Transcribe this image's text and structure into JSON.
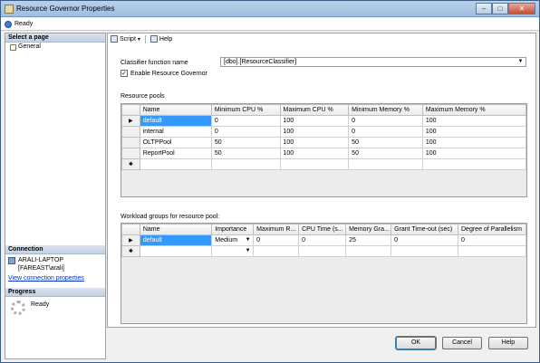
{
  "window": {
    "title": "Resource Governor Properties"
  },
  "status": {
    "text": "Ready"
  },
  "left": {
    "select_header": "Select a page",
    "pages": [
      "General"
    ],
    "connection_header": "Connection",
    "server": "ARALI-LAPTOP",
    "user": "[FAREAST\\arali]",
    "view_link": "View connection properties",
    "progress_header": "Progress",
    "progress_text": "Ready"
  },
  "toolbar": {
    "script": "Script",
    "help": "Help"
  },
  "form": {
    "classifier_label": "Classifier function name",
    "classifier_value": "[dbo].[ResourceClassifier]",
    "enable_label": "Enable Resource Governor",
    "pools_label": "Resource pools",
    "workload_label": "Workload groups for resource pool:"
  },
  "pools": {
    "headers": [
      "Name",
      "Minimum CPU %",
      "Maximum CPU %",
      "Minimum Memory %",
      "Maximum Memory %"
    ],
    "rows": [
      [
        "default",
        "0",
        "100",
        "0",
        "100"
      ],
      [
        "internal",
        "0",
        "100",
        "0",
        "100"
      ],
      [
        "OLTPPool",
        "50",
        "100",
        "50",
        "100"
      ],
      [
        "ReportPool",
        "50",
        "100",
        "50",
        "100"
      ]
    ]
  },
  "workload": {
    "headers": [
      "Name",
      "Importance",
      "Maximum R...",
      "CPU Time (s...",
      "Memory Gra...",
      "Grant Time-out (sec)",
      "Degree of Parallelism"
    ],
    "rows": [
      [
        "default",
        "Medium",
        "0",
        "0",
        "25",
        "0",
        "0"
      ]
    ]
  },
  "buttons": {
    "ok": "OK",
    "cancel": "Cancel",
    "help": "Help"
  }
}
